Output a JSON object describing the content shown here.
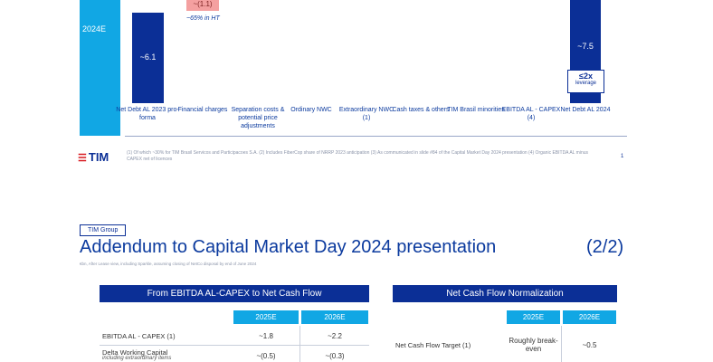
{
  "slide1": {
    "cyan_label": "2024E",
    "bars": {
      "net_debt_2023": "~6.1",
      "net_debt_2024": "~7.5"
    },
    "financial_charges_value": "~(1.1)",
    "financial_charges_note": "~65% in HT",
    "leverage": {
      "value": "≤2x",
      "label": "leverage"
    },
    "categories": [
      "Net Debt AL 2023 pro-forma",
      "Financial charges",
      "Separation costs & potential price adjustments",
      "Ordinary NWC",
      "Extraordinary NWC (1)",
      "Cash taxes & others",
      "TIM Brasil minorities",
      "EBITDA AL - CAPEX (4)",
      "Net Debt AL 2024"
    ],
    "logo_text": "TIM",
    "footnotes": "(1) Of which ~30% for TIM Brasil Servicos and Participacoes S.A.      (2) Includes FiberCop share of NRRP 2023 anticipation      (3) As communicated in slide #84 of the Capital Market Day 2024 presentation      (4) Organic EBITDA AL minus CAPEX net of licences",
    "page_number": "1"
  },
  "slide2": {
    "group_tag": "TIM Group",
    "title": "Addendum to Capital Market Day 2024 presentation",
    "title_part": "(2/2)",
    "subtitle": "€bn, After Lease view, including Sparkle, assuming closing of NetCo disposal by end of June 2024",
    "left_table": {
      "header": "From EBITDA AL-CAPEX to Net Cash Flow",
      "columns": [
        "2025E",
        "2026E"
      ],
      "rows": [
        {
          "label": "EBITDA AL - CAPEX (1)",
          "sub": "",
          "values": [
            "~1.8",
            "~2.2"
          ]
        },
        {
          "label": "Delta Working Capital",
          "sub": "including extraordinary items",
          "values": [
            "~(0.5)",
            "~(0.3)"
          ]
        }
      ]
    },
    "right_table": {
      "header": "Net Cash Flow Normalization",
      "columns": [
        "2025E",
        "2026E"
      ],
      "rows": [
        {
          "label": "Net Cash Flow Target (1)",
          "values": [
            "Roughly break-even",
            "~0.5"
          ]
        }
      ]
    }
  }
}
